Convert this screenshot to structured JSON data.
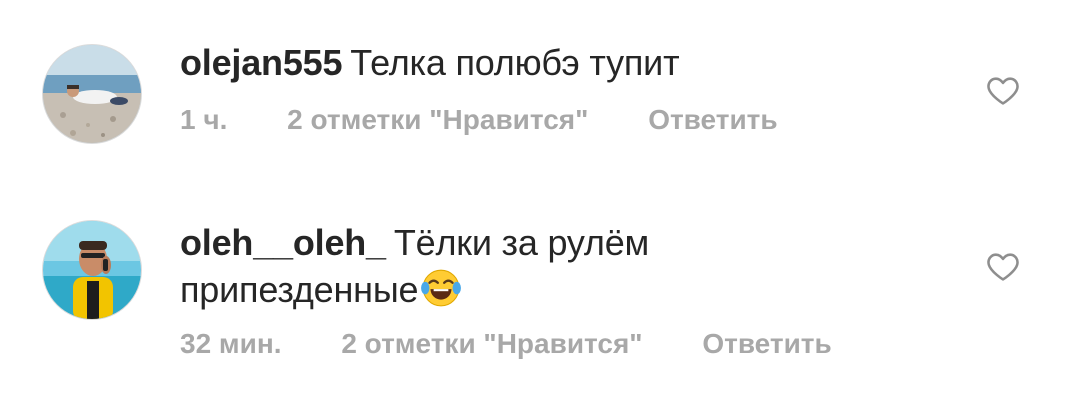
{
  "comments": [
    {
      "username": "olejan555",
      "text": "Телка полюбэ тупит",
      "time": "1 ч.",
      "likes": "2 отметки \"Нравится\"",
      "reply": "Ответить",
      "like_icon": "heart-outline-icon"
    },
    {
      "username": "oleh__oleh_",
      "text_line1": "Тёлки за рулём",
      "text_line2": "припезденные",
      "emoji": "face-with-tears-of-joy",
      "time": "32 мин.",
      "likes": "2 отметки \"Нравится\"",
      "reply": "Ответить",
      "like_icon": "heart-outline-icon"
    }
  ],
  "colors": {
    "text": "#262626",
    "secondary": "#a8a8a8"
  }
}
